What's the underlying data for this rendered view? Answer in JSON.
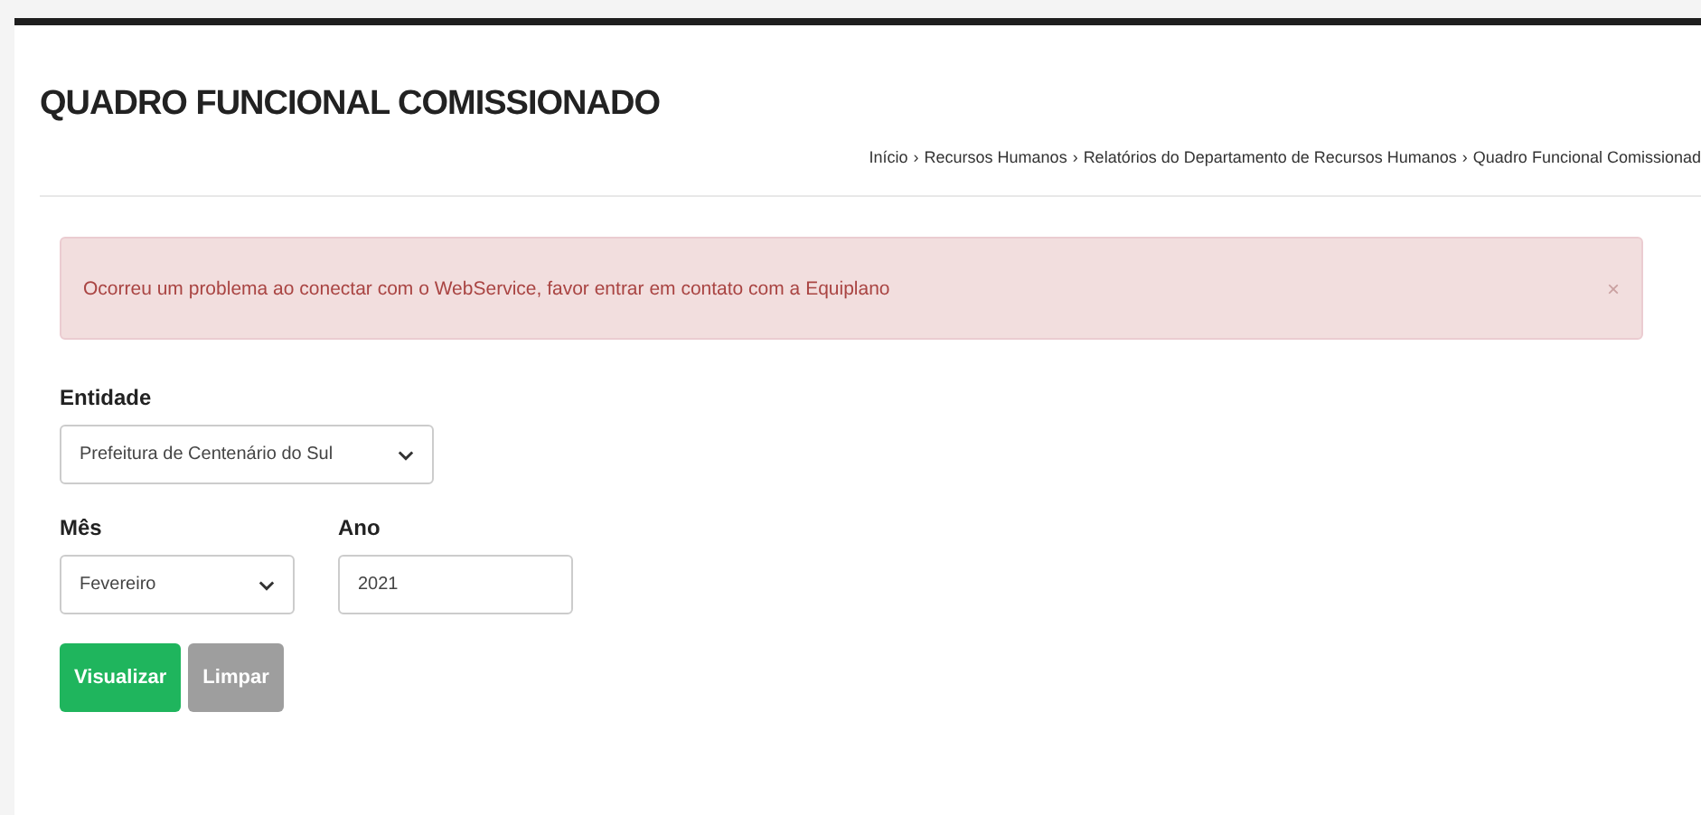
{
  "page": {
    "title": "QUADRO FUNCIONAL COMISSIONADO"
  },
  "breadcrumb": {
    "separator": "›",
    "items": [
      {
        "label": "Início"
      },
      {
        "label": "Recursos Humanos"
      },
      {
        "label": "Relatórios do Departamento de Recursos Humanos"
      },
      {
        "label": "Quadro Funcional Comissionad"
      }
    ]
  },
  "alert": {
    "message": "Ocorreu um problema ao conectar com o WebService, favor entrar em contato com a Equiplano",
    "close": "×"
  },
  "form": {
    "entity": {
      "label": "Entidade",
      "value": "Prefeitura de Centenário do Sul"
    },
    "month": {
      "label": "Mês",
      "value": "Fevereiro"
    },
    "year": {
      "label": "Ano",
      "value": "2021"
    }
  },
  "buttons": [
    {
      "kind": "primary",
      "label": "Visualizar"
    },
    {
      "kind": "secondary",
      "label": "Limpar"
    }
  ]
}
